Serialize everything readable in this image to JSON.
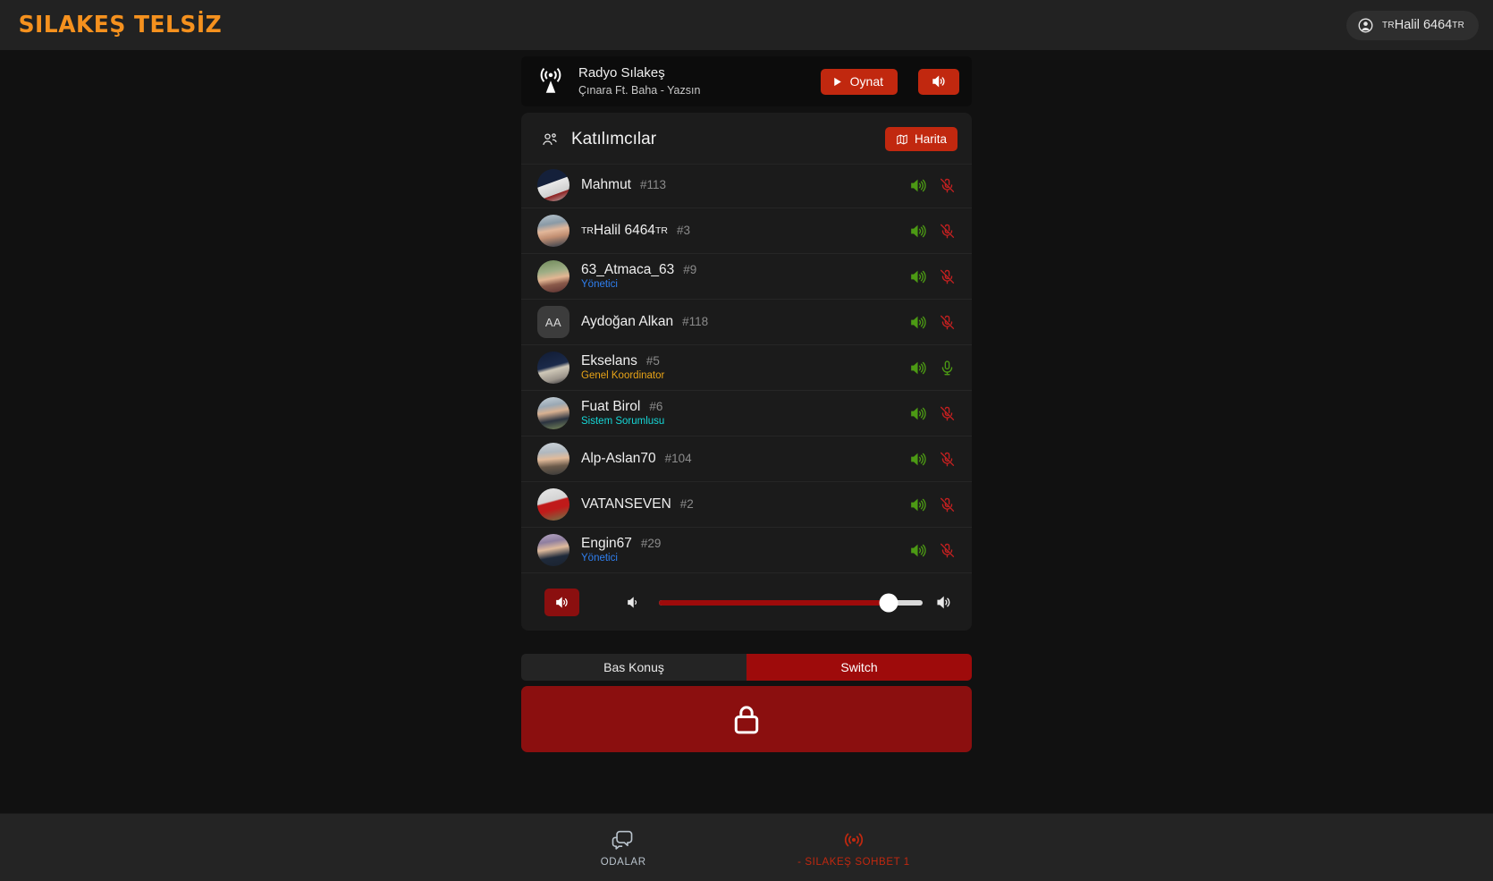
{
  "header": {
    "logo": "SILAKEŞ TELSİZ",
    "user": {
      "prefix": "TR",
      "name": "Halil 6464",
      "suffix": "TR",
      "icon": "user-circle-icon"
    }
  },
  "radio": {
    "icon": "broadcast-tower-icon",
    "title": "Radyo Sılakeş",
    "now_playing": "Çınara Ft. Baha - Yazsın",
    "play_label": "Oynat",
    "play_icon": "play-icon",
    "speaker_icon": "volume-high-icon"
  },
  "participants": {
    "icon": "people-icon",
    "title": "Katılımcılar",
    "map_label": "Harita",
    "map_icon": "map-icon",
    "rows": [
      {
        "name": "Mahmut",
        "tag": "#113",
        "role": "",
        "role_color": "",
        "avatar": "photo",
        "avatar_class": "av1",
        "initials": "",
        "speaker": "on",
        "mic": "off"
      },
      {
        "name": "Halil 6464",
        "prefix": "TR",
        "suffix": "TR",
        "tag": "#3",
        "role": "",
        "role_color": "",
        "avatar": "photo",
        "avatar_class": "av2",
        "initials": "",
        "speaker": "on",
        "mic": "off"
      },
      {
        "name": "63_Atmaca_63",
        "tag": "#9",
        "role": "Yönetici",
        "role_color": "#2f7ff0",
        "avatar": "photo",
        "avatar_class": "av3",
        "initials": "",
        "speaker": "on",
        "mic": "off"
      },
      {
        "name": "Aydoğan Alkan",
        "tag": "#118",
        "role": "",
        "role_color": "",
        "avatar": "initials",
        "avatar_class": "av0",
        "initials": "AA",
        "speaker": "on",
        "mic": "off"
      },
      {
        "name": "Ekselans",
        "tag": "#5",
        "role": "Genel Koordinator",
        "role_color": "#e8a317",
        "avatar": "photo",
        "avatar_class": "av4",
        "initials": "",
        "speaker": "on",
        "mic": "on"
      },
      {
        "name": "Fuat Birol",
        "tag": "#6",
        "role": "Sistem Sorumlusu",
        "role_color": "#16d6d6",
        "avatar": "photo",
        "avatar_class": "av5",
        "initials": "",
        "speaker": "on",
        "mic": "off"
      },
      {
        "name": "Alp-Aslan70",
        "tag": "#104",
        "role": "",
        "role_color": "",
        "avatar": "photo",
        "avatar_class": "av6",
        "initials": "",
        "speaker": "on",
        "mic": "off"
      },
      {
        "name": "VATANSEVEN",
        "tag": "#2",
        "role": "",
        "role_color": "",
        "avatar": "photo",
        "avatar_class": "av7",
        "initials": "",
        "speaker": "on",
        "mic": "off"
      },
      {
        "name": "Engin67",
        "tag": "#29",
        "role": "Yönetici",
        "role_color": "#2f7ff0",
        "avatar": "photo",
        "avatar_class": "av8",
        "initials": "",
        "speaker": "on",
        "mic": "off"
      }
    ]
  },
  "volume": {
    "mute_icon": "volume-high-icon",
    "low_icon": "volume-low-icon",
    "high_icon": "volume-high-icon",
    "level": 87
  },
  "ptt": {
    "push_label": "Bas Konuş",
    "switch_label": "Switch",
    "active": "switch",
    "lock_icon": "lock-icon"
  },
  "bottom_nav": [
    {
      "label": "ODALAR",
      "icon": "chat-bubbles-icon",
      "active": false
    },
    {
      "label": "- SILAKEŞ SOHBET 1",
      "icon": "broadcast-icon",
      "active": true
    }
  ],
  "colors": {
    "brand_orange": "#f5911e",
    "accent_red": "#c1280f",
    "deep_red": "#8b0f0f",
    "green": "#4c9a14",
    "mic_red": "#c42020"
  }
}
